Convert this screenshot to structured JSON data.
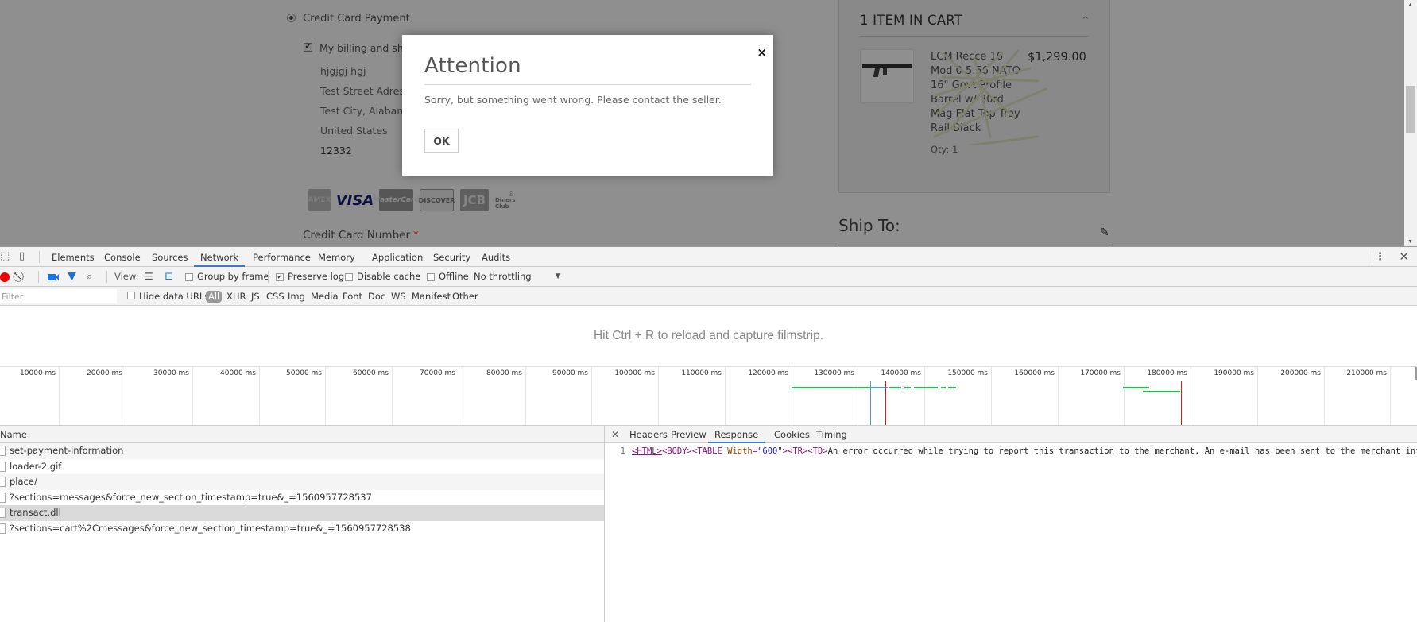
{
  "page": {
    "payment_method_label": "Credit Card Payment",
    "billing_same_label": "My billing and shipping address are the same",
    "address_lines": [
      "hjgjgj hgj",
      "Test Street Adress",
      "Test City, Alabama",
      "United States",
      "12332"
    ],
    "card_logos": [
      "American Express",
      "VISA",
      "MasterCard",
      "DISCOVER",
      "JCB",
      "Diners Club"
    ],
    "card_number_label": "Credit Card Number",
    "required_mark": "*",
    "cart": {
      "title": "1 ITEM IN CART",
      "item_name": "LCM Recce 16 Mod 0 5.56 NATO 16\" Govt Profile Barrel w/ 30rd Mag Flat Top Troy Rail Black",
      "item_price": "$1,299.00",
      "item_qty": "Qty: 1"
    },
    "ship_to_label": "Ship To:"
  },
  "modal": {
    "title": "Attention",
    "message": "Sorry, but something went wrong. Please contact the seller.",
    "ok_label": "OK",
    "close_glyph": "×"
  },
  "devtools": {
    "tabs": [
      {
        "label": "Elements",
        "active": false
      },
      {
        "label": "Console",
        "active": false
      },
      {
        "label": "Sources",
        "active": false
      },
      {
        "label": "Network",
        "active": true
      },
      {
        "label": "Performance",
        "active": false
      },
      {
        "label": "Memory",
        "active": false
      },
      {
        "label": "Application",
        "active": false
      },
      {
        "label": "Security",
        "active": false
      },
      {
        "label": "Audits",
        "active": false
      }
    ],
    "toolbar": {
      "view_label": "View:",
      "group_by_frame": {
        "label": "Group by frame",
        "checked": false
      },
      "preserve_log": {
        "label": "Preserve log",
        "checked": true
      },
      "disable_cache": {
        "label": "Disable cache",
        "checked": false
      },
      "offline": {
        "label": "Offline",
        "checked": false
      },
      "throttling": "No throttling"
    },
    "filter": {
      "placeholder": "Filter",
      "hide_data_urls": {
        "label": "Hide data URLs",
        "checked": false
      },
      "types": [
        "All",
        "XHR",
        "JS",
        "CSS",
        "Img",
        "Media",
        "Font",
        "Doc",
        "WS",
        "Manifest",
        "Other"
      ],
      "active_type": "All"
    },
    "filmstrip_message": "Hit Ctrl + R to reload and capture filmstrip.",
    "timeline": {
      "unit": "ms",
      "ticks": [
        10000,
        20000,
        30000,
        40000,
        50000,
        60000,
        70000,
        80000,
        90000,
        100000,
        110000,
        120000,
        130000,
        140000,
        150000,
        160000,
        170000,
        180000,
        190000,
        200000,
        210000
      ],
      "bars": [
        {
          "start": 120000,
          "end": 134500,
          "row": 0,
          "color": "#1fbf4f"
        },
        {
          "start": 132000,
          "end": 134500,
          "row": 0,
          "color": "#4a9be6"
        },
        {
          "start": 134800,
          "end": 136500,
          "row": 0,
          "color": "#1fbf4f"
        },
        {
          "start": 137000,
          "end": 138000,
          "row": 0,
          "color": "#1fbf4f"
        },
        {
          "start": 138500,
          "end": 142000,
          "row": 0,
          "color": "#1fbf4f"
        },
        {
          "start": 142500,
          "end": 143200,
          "row": 0,
          "color": "#1fbf4f"
        },
        {
          "start": 143600,
          "end": 144800,
          "row": 0,
          "color": "#1fbf4f"
        },
        {
          "start": 169800,
          "end": 173800,
          "row": 0,
          "color": "#1fbf4f"
        },
        {
          "start": 172800,
          "end": 178500,
          "row": 1,
          "color": "#1fbf4f"
        }
      ],
      "dom_content_loaded_ms": 131900,
      "load_ms": [
        134200,
        178600
      ]
    },
    "requests": {
      "column_name": "Name",
      "rows": [
        {
          "name": "set-payment-information",
          "selected": false
        },
        {
          "name": "loader-2.gif",
          "selected": false
        },
        {
          "name": "place/",
          "selected": false
        },
        {
          "name": "?sections=messages&force_new_section_timestamp=true&_=1560957728537",
          "selected": false
        },
        {
          "name": "transact.dll",
          "selected": true
        },
        {
          "name": "?sections=cart%2Cmessages&force_new_section_timestamp=true&_=1560957728538",
          "selected": false
        }
      ]
    },
    "detail": {
      "tabs": [
        {
          "label": "Headers",
          "active": false
        },
        {
          "label": "Preview",
          "active": false
        },
        {
          "label": "Response",
          "active": true
        },
        {
          "label": "Cookies",
          "active": false
        },
        {
          "label": "Timing",
          "active": false
        }
      ],
      "response_line_number": "1",
      "response_html_open": "<HTML>",
      "response_body_open": "<BODY>",
      "response_table_tag": "<TABLE ",
      "response_table_attr": "Width",
      "response_table_eq": "=",
      "response_table_val": "\"600\"",
      "response_table_close": ">",
      "response_tr_td": "<TR><TD>",
      "response_text": "An error occurred while trying to report this transaction to the merchant. An e-mail has been sent to the merchant informing them of the error."
    }
  }
}
